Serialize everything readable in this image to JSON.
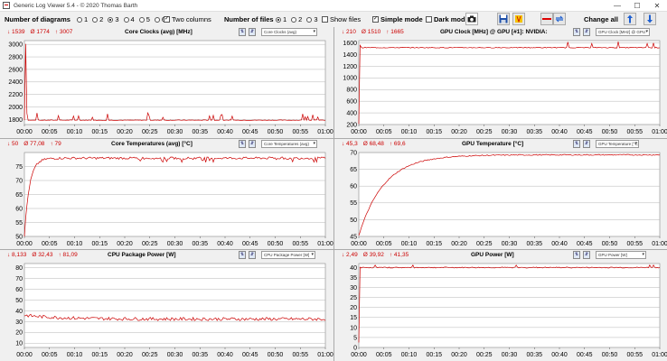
{
  "window": {
    "title": "Generic Log Viewer 5.4 - © 2020 Thomas Barth",
    "minimize": "—",
    "maximize": "☐",
    "close": "✕"
  },
  "toolbar": {
    "num_diagrams_label": "Number of diagrams",
    "diagram_options": [
      "1",
      "2",
      "3",
      "4",
      "5",
      "6"
    ],
    "diagram_selected": "3",
    "two_columns_label": "Two columns",
    "two_columns_checked": true,
    "num_files_label": "Number of files",
    "file_options": [
      "1",
      "2",
      "3"
    ],
    "file_selected": "1",
    "show_files_label": "Show files",
    "show_files_checked": false,
    "simple_mode_label": "Simple mode",
    "simple_mode_checked": true,
    "dark_mode_label": "Dark mod",
    "dark_mode_checked": false,
    "change_all_label": "Change all",
    "icons": [
      "camera-icon",
      "save-icon",
      "folder-icon",
      "line-style-icon",
      "refresh-icon",
      "cursor-up-icon",
      "cursor-down-icon"
    ]
  },
  "panels": [
    {
      "id": "core-clocks",
      "stats": {
        "min": "↓ 1539",
        "avg": "Ø 1774",
        "max": "↑ 3007"
      },
      "title": "Core Clocks (avg) [MHz]",
      "selector": "Core Clocks (avg)",
      "chart_data": {
        "type": "line",
        "x": [
          "00:00",
          "00:05",
          "00:10",
          "00:15",
          "00:20",
          "00:25",
          "00:30",
          "00:35",
          "00:40",
          "00:45",
          "00:50",
          "00:55",
          "01:00"
        ],
        "y_ticks": [
          1800,
          2000,
          2200,
          2400,
          2600,
          2800,
          3000
        ],
        "ylim": [
          1720,
          3060
        ],
        "series": [
          {
            "baseline": 1790,
            "max": 3007,
            "spikes": "frequent short spikes to ~1850-1900"
          }
        ]
      }
    },
    {
      "id": "gpu-clock",
      "stats": {
        "min": "↓ 210",
        "avg": "Ø 1510",
        "max": "↑ 1665"
      },
      "title": "GPU Clock [MHz] @ GPU [#1]: NVIDIA:",
      "selector": "GPU Clock [MHz] @ GPU",
      "chart_data": {
        "type": "line",
        "x": [
          "00:00",
          "00:05",
          "00:10",
          "00:15",
          "00:20",
          "00:25",
          "00:30",
          "00:35",
          "00:40",
          "00:45",
          "00:50",
          "00:55",
          "01:00"
        ],
        "y_ticks": [
          200,
          400,
          600,
          800,
          1000,
          1200,
          1400,
          1600
        ],
        "ylim": [
          200,
          1640
        ],
        "series": [
          {
            "baseline": 1520,
            "max": 1665,
            "min": 210
          }
        ]
      }
    },
    {
      "id": "core-temps",
      "stats": {
        "min": "↓ 50",
        "avg": "Ø 77,08",
        "max": "↑ 79"
      },
      "title": "Core Temperatures (avg) [°C]",
      "selector": "Core Temperatures (avg)",
      "chart_data": {
        "type": "line",
        "x": [
          "00:00",
          "00:05",
          "00:10",
          "00:15",
          "00:20",
          "00:25",
          "00:30",
          "00:35",
          "00:40",
          "00:45",
          "00:50",
          "00:55",
          "01:00"
        ],
        "y_ticks": [
          50,
          55,
          60,
          65,
          70,
          75
        ],
        "ylim": [
          50,
          80
        ],
        "series": [
          {
            "start": 50,
            "plateau": 78,
            "max": 79
          }
        ]
      }
    },
    {
      "id": "gpu-temp",
      "stats": {
        "min": "↓ 45,3",
        "avg": "Ø 68,48",
        "max": "↑ 69,6"
      },
      "title": "GPU Temperature [°C]",
      "selector": "GPU Temperature [°C]",
      "chart_data": {
        "type": "line",
        "x": [
          "00:00",
          "00:05",
          "00:10",
          "00:15",
          "00:20",
          "00:25",
          "00:30",
          "00:35",
          "00:40",
          "00:45",
          "00:50",
          "00:55",
          "01:00"
        ],
        "y_ticks": [
          45,
          50,
          55,
          60,
          65,
          70
        ],
        "ylim": [
          45,
          70
        ],
        "series": [
          {
            "start": 45.3,
            "plateau": 69.4,
            "max": 69.6
          }
        ]
      }
    },
    {
      "id": "cpu-power",
      "stats": {
        "min": "↓ 8,133",
        "avg": "Ø 32,43",
        "max": "↑ 81,09"
      },
      "title": "CPU Package Power [W]",
      "selector": "CPU Package Power [W]",
      "chart_data": {
        "type": "line",
        "x": [
          "00:00",
          "00:05",
          "00:10",
          "00:15",
          "00:20",
          "00:25",
          "00:30",
          "00:35",
          "00:40",
          "00:45",
          "00:50",
          "00:55",
          "01:00"
        ],
        "y_ticks": [
          10,
          20,
          30,
          40,
          50,
          60,
          70,
          80
        ],
        "ylim": [
          6,
          84
        ],
        "series": [
          {
            "baseline": 32.4,
            "start": 36,
            "noise": 1.5
          }
        ]
      }
    },
    {
      "id": "gpu-power",
      "stats": {
        "min": "↓ 2,49",
        "avg": "Ø 39,92",
        "max": "↑ 41,35"
      },
      "title": "GPU Power [W]",
      "selector": "GPU Power [W]",
      "chart_data": {
        "type": "line",
        "x": [
          "00:00",
          "00:05",
          "00:10",
          "00:15",
          "00:20",
          "00:25",
          "00:30",
          "00:35",
          "00:40",
          "00:45",
          "00:50",
          "00:55",
          "01:00"
        ],
        "y_ticks": [
          0,
          5,
          10,
          15,
          20,
          25,
          30,
          35,
          40
        ],
        "ylim": [
          0,
          42
        ],
        "series": [
          {
            "start": 2.49,
            "plateau": 40,
            "max": 41.35
          }
        ]
      }
    }
  ]
}
